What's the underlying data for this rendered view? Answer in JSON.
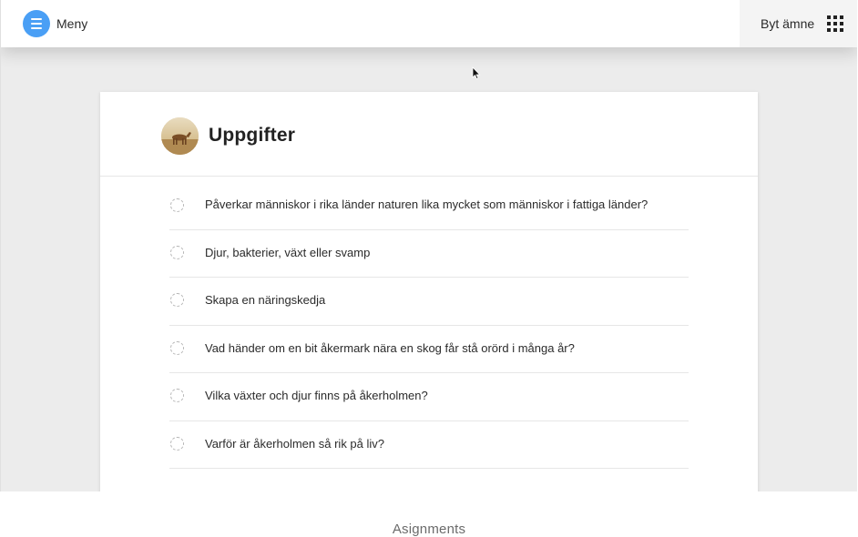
{
  "header": {
    "menu_label": "Meny",
    "subject_label": "Byt ämne"
  },
  "card": {
    "title": "Uppgifter",
    "tasks": [
      {
        "label": "Påverkar människor i rika länder naturen lika mycket som människor i fattiga länder?"
      },
      {
        "label": "Djur, bakterier, växt eller svamp"
      },
      {
        "label": "Skapa en näringskedja"
      },
      {
        "label": "Vad händer om en bit åkermark nära en skog får stå orörd i många år?"
      },
      {
        "label": "Vilka växter och djur finns på åkerholmen?"
      },
      {
        "label": "Varför är åkerholmen så rik på liv?"
      }
    ]
  },
  "footer": {
    "label": "Asignments"
  },
  "colors": {
    "accent": "#4a9ff5",
    "background": "#ececec"
  },
  "icons": {
    "menu": "hamburger-menu-icon",
    "subject": "app-grid-icon",
    "task_status": "dashed-circle-icon"
  }
}
